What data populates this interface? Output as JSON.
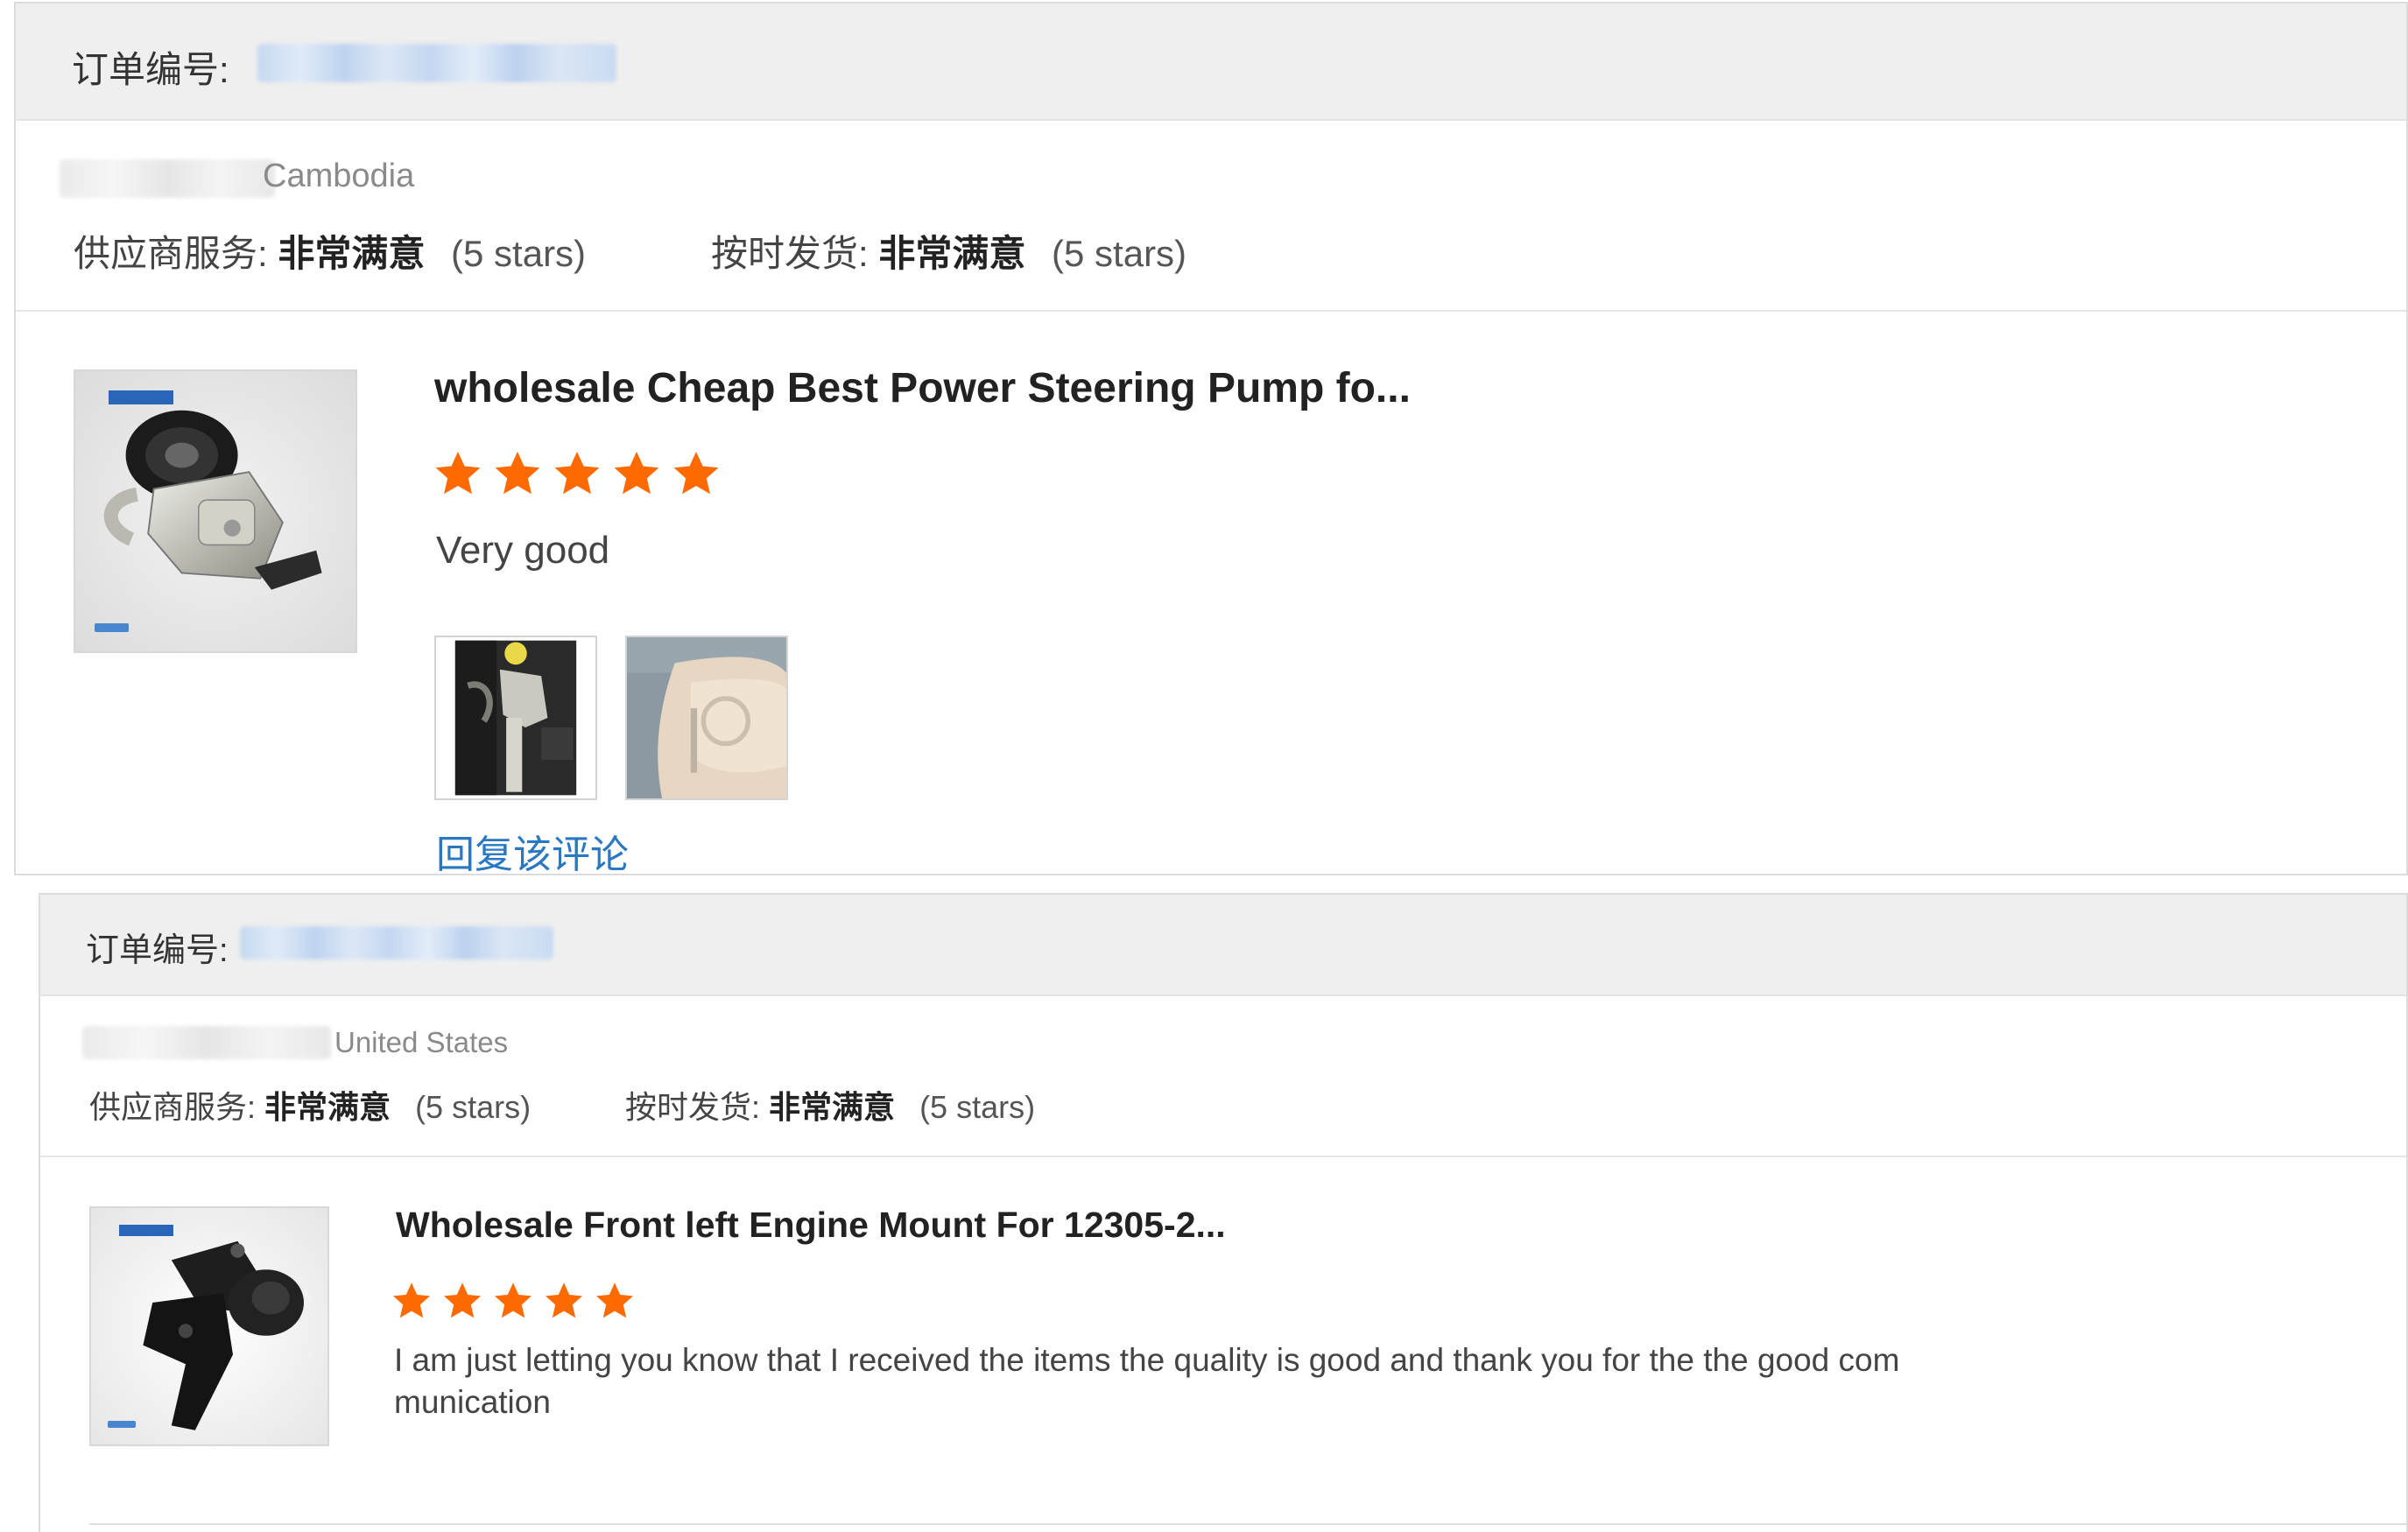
{
  "order_label": "订单编号:",
  "rating_labels": {
    "supplier_service": "供应商服务:",
    "on_time_delivery": "按时发货:"
  },
  "accent_colors": {
    "star": "#ff6a00",
    "link": "#2a78c2"
  },
  "reviews": [
    {
      "country": "Cambodia",
      "supplier_service": {
        "value": "非常满意",
        "stars_text": "(5 stars)"
      },
      "on_time_delivery": {
        "value": "非常满意",
        "stars_text": "(5 stars)"
      },
      "product_title": "wholesale Cheap Best Power Steering Pump fo...",
      "product_image_icon": "power-steering-pump-image",
      "rating": 5,
      "comment": "Very good",
      "photos": [
        "review-photo-1",
        "review-photo-2"
      ],
      "reply_label": "回复该评论"
    },
    {
      "country": "United States",
      "supplier_service": {
        "value": "非常满意",
        "stars_text": "(5 stars)"
      },
      "on_time_delivery": {
        "value": "非常满意",
        "stars_text": "(5 stars)"
      },
      "product_title": "Wholesale Front left Engine Mount For 12305-2...",
      "product_image_icon": "engine-mount-image",
      "rating": 5,
      "comment": "I am just letting you know that I received  the items the quality is good and thank you for the the good com munication"
    }
  ]
}
